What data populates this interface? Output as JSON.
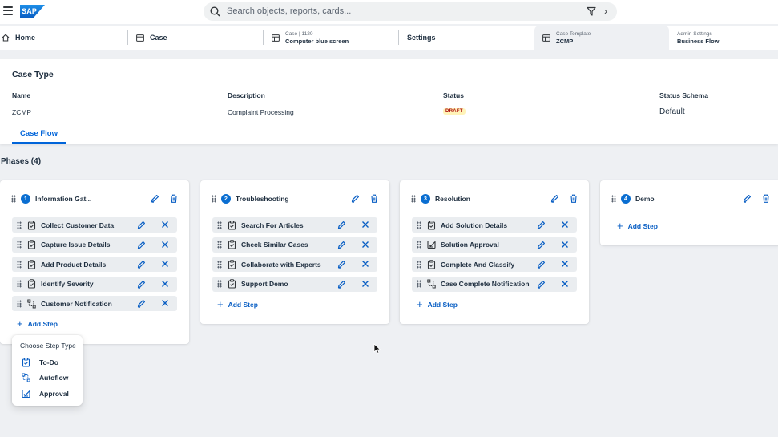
{
  "shell": {
    "logo_text": "SAP",
    "search_placeholder": "Search objects, reports, cards..."
  },
  "tabs": {
    "home": "Home",
    "case": "Case",
    "case_detail_small": "Case | 1120",
    "case_detail_big": "Computer blue screen",
    "settings": "Settings",
    "template_small": "Case Template",
    "template_big": "ZCMP",
    "admin_small": "Admin Settings",
    "admin_big": "Business Flow"
  },
  "header": {
    "title": "Case Type",
    "name_label": "Name",
    "name_value": "ZCMP",
    "description_label": "Description",
    "description_value": "Complaint Processing",
    "status_label": "Status",
    "status_value": "DRAFT",
    "schema_label": "Status Schema",
    "schema_value": "Default",
    "flow_tab": "Case Flow"
  },
  "phases_title": "Phases (4)",
  "phases": [
    {
      "number": "1",
      "name": "Information Gat...",
      "steps": [
        {
          "name": "Collect Customer Data",
          "type": "todo"
        },
        {
          "name": "Capture Issue Details",
          "type": "todo"
        },
        {
          "name": "Add Product Details",
          "type": "todo"
        },
        {
          "name": "Identify Severity",
          "type": "todo"
        },
        {
          "name": "Customer Notification",
          "type": "autoflow"
        }
      ],
      "add_label": "Add Step"
    },
    {
      "number": "2",
      "name": "Troubleshooting",
      "steps": [
        {
          "name": "Search For Articles",
          "type": "todo"
        },
        {
          "name": "Check Similar Cases",
          "type": "todo"
        },
        {
          "name": "Collaborate with Experts",
          "type": "todo"
        },
        {
          "name": "Support Demo",
          "type": "todo"
        }
      ],
      "add_label": "Add Step"
    },
    {
      "number": "3",
      "name": "Resolution",
      "steps": [
        {
          "name": "Add Solution Details",
          "type": "todo"
        },
        {
          "name": "Solution Approval",
          "type": "approval"
        },
        {
          "name": "Complete And Classify",
          "type": "todo"
        },
        {
          "name": "Case Complete Notification",
          "type": "autoflow"
        }
      ],
      "add_label": "Add Step"
    },
    {
      "number": "4",
      "name": "Demo",
      "steps": [],
      "add_label": "Add Step"
    }
  ],
  "popover": {
    "title": "Choose Step Type",
    "options": [
      "To-Do",
      "Autoflow",
      "Approval"
    ]
  },
  "colors": {
    "accent": "#0a6ed1",
    "link": "#0a5fc4",
    "draft_text": "#aa0808",
    "draft_bg": "#fff3b8"
  },
  "icons": [
    "menu-icon",
    "search-icon",
    "filter-icon",
    "chevron-right-icon",
    "home-icon",
    "object-icon",
    "drag-handle-icon",
    "edit-icon",
    "delete-icon",
    "close-icon",
    "todo-icon",
    "autoflow-icon",
    "approval-icon",
    "add-icon",
    "mouse-cursor-icon"
  ]
}
